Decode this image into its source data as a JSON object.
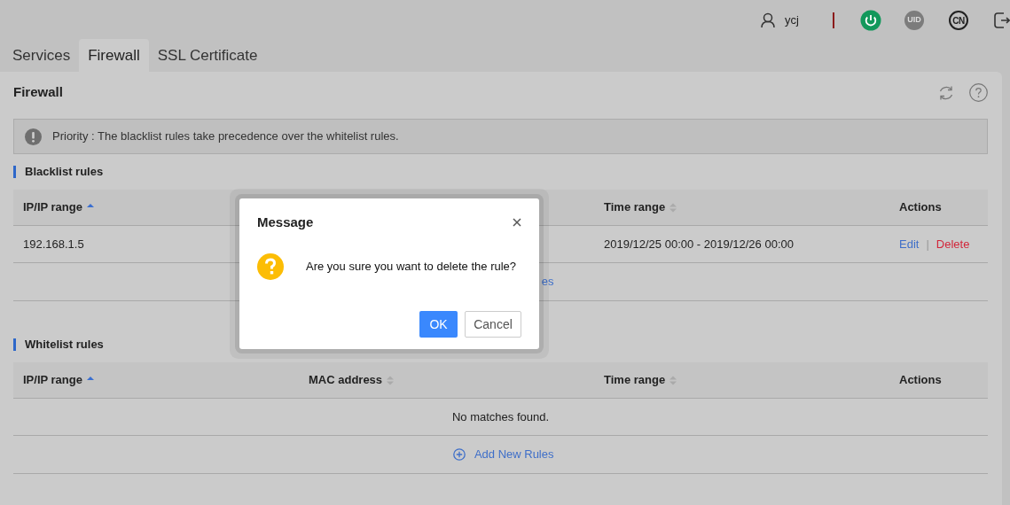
{
  "header": {
    "user": "ycj",
    "power_on": true,
    "uid_label": "UID",
    "lang_label": "CN"
  },
  "tabs": [
    {
      "label": "Services",
      "selected": false
    },
    {
      "label": "Firewall",
      "selected": true
    },
    {
      "label": "SSL Certificate",
      "selected": false
    }
  ],
  "page": {
    "title": "Firewall"
  },
  "alert": {
    "text": "Priority : The blacklist rules take precedence over the whitelist rules."
  },
  "sections": [
    {
      "title": "Blacklist rules",
      "columns": [
        {
          "label": "IP/IP range",
          "kind": "ip",
          "sorted": true
        },
        {
          "label": "Time range",
          "kind": "time",
          "sorted": false
        },
        {
          "label": "Actions",
          "kind": "actions"
        }
      ],
      "rows": [
        {
          "ip": "192.168.1.5",
          "time": "2019/12/25 00:00 - 2019/12/26 00:00",
          "actions": [
            {
              "label": "Edit",
              "kind": "edit"
            },
            {
              "label": "|",
              "kind": "separator"
            },
            {
              "label": "Delete",
              "kind": "delete"
            }
          ]
        }
      ],
      "add_link": {
        "label": "es",
        "icon": false
      }
    },
    {
      "title": "Whitelist rules",
      "columns": [
        {
          "label": "IP/IP range",
          "kind": "ip",
          "sorted": true
        },
        {
          "label": "MAC address",
          "kind": "mac",
          "sorted": false
        },
        {
          "label": "Time range",
          "kind": "time",
          "sorted": false
        },
        {
          "label": "Actions",
          "kind": "actions"
        }
      ],
      "empty_text": "No matches found.",
      "add_link": {
        "label": "Add New Rules",
        "icon": true
      }
    }
  ],
  "dialog": {
    "title": "Message",
    "message": "Are you sure you want to delete the rule?",
    "buttons": [
      {
        "label": "OK",
        "kind": "primary"
      },
      {
        "label": "Cancel",
        "kind": "secondary"
      }
    ]
  }
}
